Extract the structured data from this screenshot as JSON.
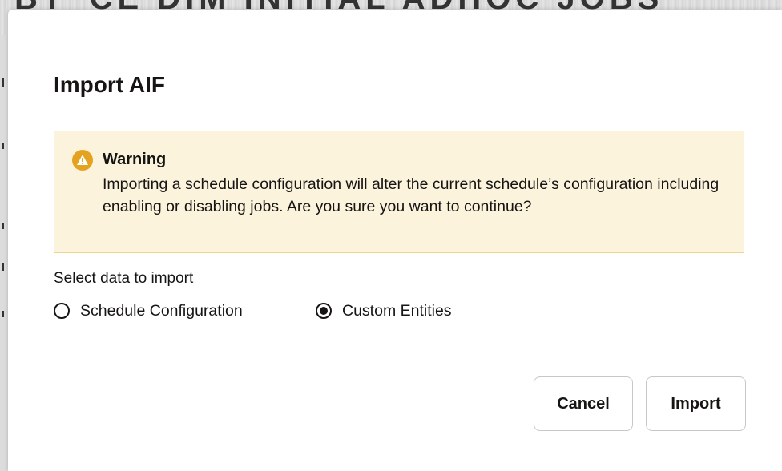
{
  "background": {
    "title_fragment": "BT_CE DIM INITIAL ADHOC JOBS"
  },
  "dialog": {
    "title": "Import AIF",
    "warning": {
      "icon": "warning-triangle-icon",
      "icon_color": "#e5a21f",
      "background_color": "#fcf3dd",
      "heading": "Warning",
      "message": "Importing a schedule configuration will alter the current schedule’s configuration including enabling or disabling jobs. Are you sure you want to continue?"
    },
    "select_label": "Select data to import",
    "options": [
      {
        "label": "Schedule Configuration",
        "selected": false
      },
      {
        "label": "Custom Entities",
        "selected": true
      }
    ],
    "buttons": {
      "cancel": "Cancel",
      "import": "Import"
    }
  }
}
